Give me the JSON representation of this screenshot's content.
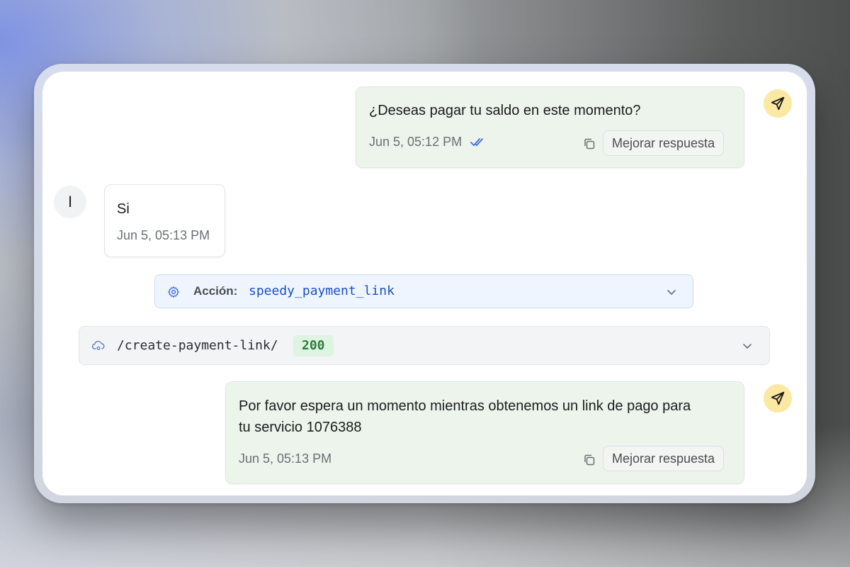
{
  "messages": [
    {
      "sender": "bot",
      "text": "¿Deseas pagar tu saldo en este momento?",
      "time": "Jun 5, 05:12 PM",
      "read_receipt": "double-check-icon",
      "improve_label": "Mejorar respuesta"
    },
    {
      "sender": "user",
      "avatar_initial": "I",
      "text": "Si",
      "time": "Jun 5, 05:13 PM"
    },
    {
      "sender": "bot",
      "text_line1": "Por favor espera un momento mientras obtenemos un link de pago para",
      "text_line2": "tu servicio 1076388",
      "time": "Jun 5, 05:13 PM",
      "improve_label": "Mejorar respuesta"
    }
  ],
  "action": {
    "label": "Acción:",
    "name": "speedy_payment_link",
    "icon": "gear-icon"
  },
  "endpoint": {
    "path": "/create-payment-link/",
    "status": "200",
    "icon": "cloud-icon"
  },
  "colors": {
    "bot_bubble": "#ecf4ec",
    "send_avatar": "#fbe8a2",
    "action_bg": "#eef5fe",
    "action_name": "#1d4fc4",
    "status_bg": "#dff3e3",
    "status_text": "#2e7d3e",
    "read_receipt": "#3b6fe0"
  }
}
